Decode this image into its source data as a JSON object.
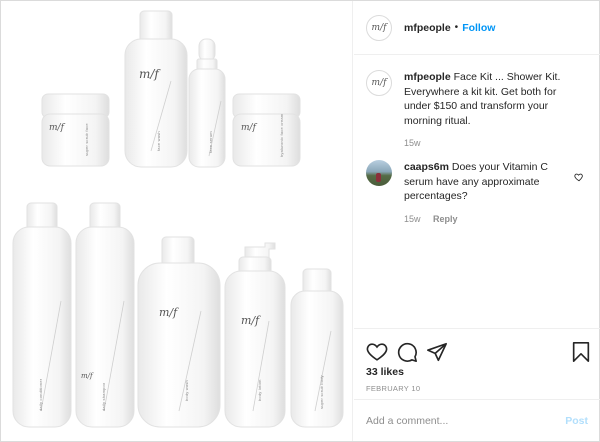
{
  "account": {
    "username": "mfpeople",
    "separator": "•",
    "follow_label": "Follow",
    "avatar_text": "m/f"
  },
  "caption": {
    "username": "mfpeople",
    "text": "Face Kit ... Shower Kit. Everywhere a kit kit. Get both for under $150 and transform your morning ritual.",
    "age": "15w"
  },
  "comments": [
    {
      "username": "caaps6m",
      "text": "Does your Vitamin C serum have any approximate percentages?",
      "age": "15w",
      "reply_label": "Reply"
    }
  ],
  "post": {
    "likes": "33 likes",
    "date": "FEBRUARY 10"
  },
  "composer": {
    "placeholder": "Add a comment...",
    "post_label": "Post"
  },
  "product_labels": {
    "jar1": "super scrub face",
    "tall": "face wash",
    "dropper": "face serum",
    "jar2": "hyaluronic face cream",
    "b1": "daily conditioner",
    "b2": "daily shampoo",
    "b3": "body wash",
    "b4": "body lotion",
    "b5": "super scrub body"
  },
  "logo_text": "m/f",
  "colors": {
    "link": "#0095f6",
    "muted": "#8e8e8e",
    "post_disabled": "#b2dffc"
  },
  "icons": [
    "heart-icon",
    "comment-icon",
    "share-icon",
    "bookmark-icon",
    "small-heart-icon"
  ]
}
